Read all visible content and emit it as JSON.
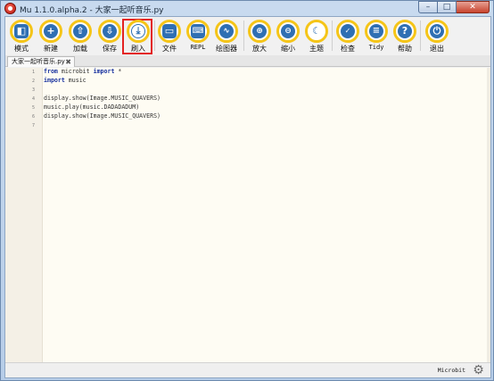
{
  "window": {
    "title": "Mu 1.1.0.alpha.2 - 大家一起听音乐.py",
    "controls": {
      "minimize": "–",
      "maximize": "□",
      "close": "✕"
    }
  },
  "toolbar": {
    "buttons": [
      {
        "id": "mode",
        "label": "模式",
        "icon": "mode-icon"
      },
      {
        "id": "new",
        "label": "新建",
        "icon": "plus-icon"
      },
      {
        "id": "load",
        "label": "加载",
        "icon": "upload-icon"
      },
      {
        "id": "save",
        "label": "保存",
        "icon": "download-icon"
      },
      {
        "id": "flash",
        "label": "刷入",
        "icon": "flash-icon",
        "highlighted": true
      },
      {
        "id": "files",
        "label": "文件",
        "icon": "files-icon"
      },
      {
        "id": "repl",
        "label": "REPL",
        "icon": "keyboard-icon"
      },
      {
        "id": "plotter",
        "label": "绘图器",
        "icon": "pulse-icon"
      },
      {
        "id": "zoom-in",
        "label": "放大",
        "icon": "zoom-in-icon"
      },
      {
        "id": "zoom-out",
        "label": "缩小",
        "icon": "zoom-out-icon"
      },
      {
        "id": "theme",
        "label": "主题",
        "icon": "moon-icon"
      },
      {
        "id": "check",
        "label": "检查",
        "icon": "thumbs-up-icon"
      },
      {
        "id": "tidy",
        "label": "Tidy",
        "icon": "list-icon"
      },
      {
        "id": "help",
        "label": "帮助",
        "icon": "question-icon"
      },
      {
        "id": "quit",
        "label": "退出",
        "icon": "power-icon"
      }
    ]
  },
  "tabs": [
    {
      "label": "大家一起听音乐.py",
      "close": "✖"
    }
  ],
  "editor": {
    "line_numbers": [
      "1",
      "2",
      "3",
      "4",
      "5",
      "6",
      "7"
    ],
    "lines": [
      {
        "kw1": "from",
        "mid": " microbit ",
        "kw2": "import",
        "rest": " *"
      },
      {
        "kw1": "import",
        "mid": " music",
        "kw2": "",
        "rest": ""
      },
      {
        "kw1": "",
        "mid": "",
        "kw2": "",
        "rest": ""
      },
      {
        "kw1": "",
        "mid": "display.show(Image.MUSIC_QUAVERS)",
        "kw2": "",
        "rest": ""
      },
      {
        "kw1": "",
        "mid": "music.play(music.DADADADUM)",
        "kw2": "",
        "rest": ""
      },
      {
        "kw1": "",
        "mid": "display.show(Image.MUSIC_QUAVERS)",
        "kw2": "",
        "rest": ""
      },
      {
        "kw1": "",
        "mid": "",
        "kw2": "",
        "rest": ""
      }
    ]
  },
  "statusbar": {
    "mode": "Microbit",
    "settings_icon": "gear-icon"
  },
  "colors": {
    "button_ring": "#f5c518",
    "button_icon": "#2f6fb3",
    "highlight": "#e32222",
    "editor_bg": "#fefcf3",
    "keyword": "#1b34a0"
  }
}
